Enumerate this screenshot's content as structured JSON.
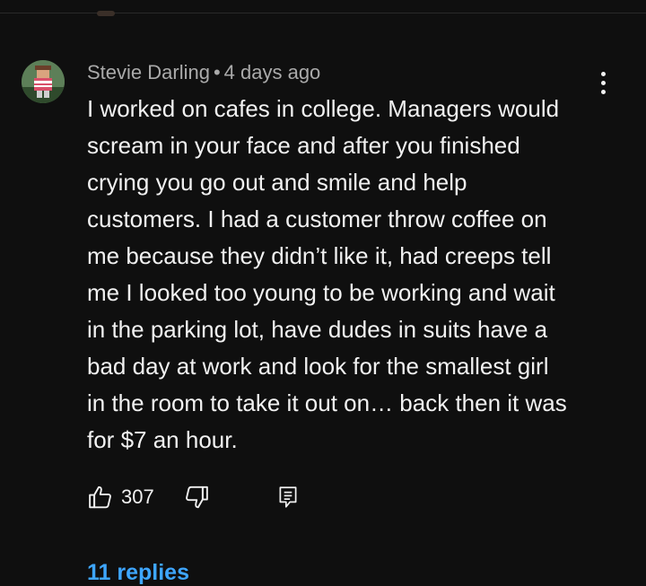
{
  "comment": {
    "author": "Stevie Darling",
    "separator": "•",
    "timestamp": "4 days ago",
    "body_lines": [
      "I worked on cafes in college. Managers would",
      "scream in your face and after you finished",
      "crying you go out and smile and help",
      "customers. I had a customer throw coffee on",
      "me because they didn’t like it, had creeps tell",
      "me I looked too young to be working and wait",
      "in the parking lot, have dudes in suits have a",
      "bad day at work and look for the smallest girl",
      "in the room to take it out on… back then it was",
      "for $7 an hour."
    ],
    "like_count": "307",
    "replies_label": "11 replies"
  },
  "icons": {
    "menu": "more-vert-icon",
    "like": "thumbs-up-icon",
    "dislike": "thumbs-down-icon",
    "reply": "reply-comment-icon"
  },
  "colors": {
    "background": "#0f0f0f",
    "text": "#f1f1f1",
    "muted": "#aaaaaa",
    "link": "#3ea6ff"
  }
}
